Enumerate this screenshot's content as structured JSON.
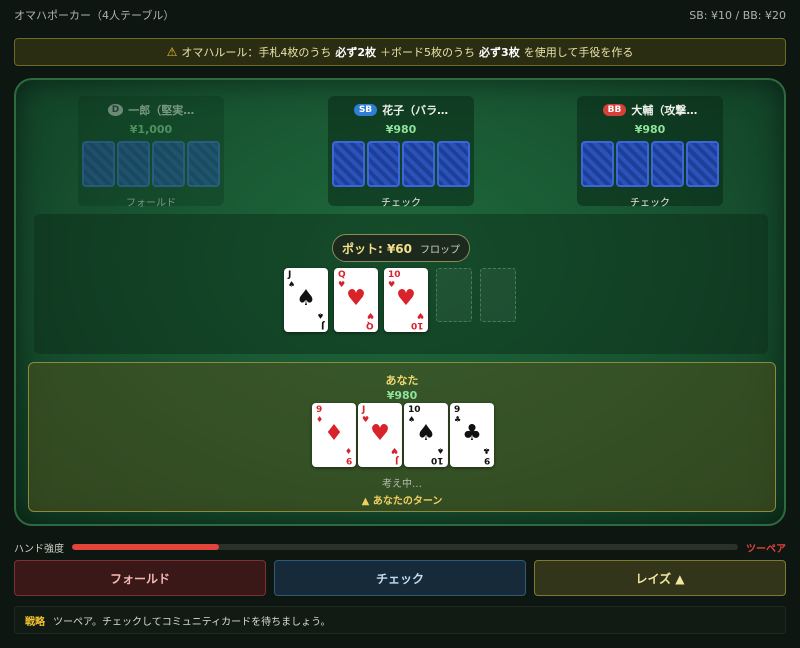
{
  "header": {
    "title": "オマハポーカー（4人テーブル）",
    "blinds": "SB: ¥10 / BB: ¥20"
  },
  "rule": {
    "prefix": "オマハルール：手札4枚のうち",
    "must2": "必ず2枚",
    "middle": "＋ボード5枚のうち",
    "must3": "必ず3枚",
    "suffix": "を使用して手役を作る"
  },
  "opponents": [
    {
      "badge": "D",
      "name": "一郎（堅実…",
      "stack": "¥1,000",
      "action": "フォールド",
      "folded": true
    },
    {
      "badge": "SB",
      "name": "花子（バラ…",
      "stack": "¥980",
      "action": "チェック",
      "folded": false
    },
    {
      "badge": "BB",
      "name": "大輔（攻撃…",
      "stack": "¥980",
      "action": "チェック",
      "folded": false
    }
  ],
  "pot": {
    "amount": "ポット: ¥60",
    "street": "フロップ"
  },
  "board": [
    {
      "rank": "J",
      "suit": "♠",
      "color": "black"
    },
    {
      "rank": "Q",
      "suit": "♥",
      "color": "red"
    },
    {
      "rank": "10",
      "suit": "♥",
      "color": "red"
    }
  ],
  "hero": {
    "name": "あなた",
    "stack": "¥980",
    "cards": [
      {
        "rank": "9",
        "suit": "♦",
        "color": "red"
      },
      {
        "rank": "J",
        "suit": "♥",
        "color": "red"
      },
      {
        "rank": "10",
        "suit": "♠",
        "color": "black"
      },
      {
        "rank": "9",
        "suit": "♣",
        "color": "black"
      }
    ],
    "status": "考え中…",
    "turn": "▲ あなたのターン"
  },
  "strength": {
    "label": "ハンド強度",
    "value": "ツーペア",
    "level": 0.22
  },
  "actions": {
    "fold": "フォールド",
    "check": "チェック",
    "raise": "レイズ ▲"
  },
  "strategy": {
    "tag": "戦略",
    "text": "ツーペア。チェックしてコミュニティカードを待ちましょう。"
  },
  "colors": {
    "felt": "#1f6a3c",
    "accent": "#f0d870",
    "stack": "#8fe29a",
    "strength": "#e2443c"
  }
}
